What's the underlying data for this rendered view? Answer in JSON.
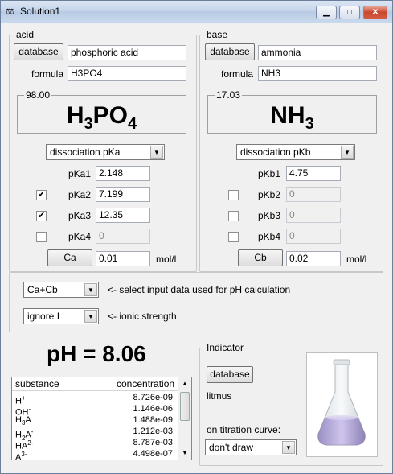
{
  "window": {
    "title": "Solution1",
    "min": "▁",
    "max": "□",
    "close": "✕"
  },
  "acid": {
    "group_label": "acid",
    "database_label": "database",
    "name_value": "phosphoric acid",
    "formula_label": "formula",
    "formula_value": "H3PO4",
    "molar_mass": "98.00",
    "formula_display": {
      "a": "H",
      "sub1": "3",
      "b": "PO",
      "sub2": "4"
    },
    "dissociation_select": "dissociation pKa",
    "pk": [
      {
        "label": "pKa1",
        "value": "2.148",
        "checked": null,
        "enabled": true
      },
      {
        "label": "pKa2",
        "value": "7.199",
        "checked": true,
        "enabled": true
      },
      {
        "label": "pKa3",
        "value": "12.35",
        "checked": true,
        "enabled": true
      },
      {
        "label": "pKa4",
        "value": "0",
        "checked": false,
        "enabled": false
      }
    ],
    "conc_button": "Ca",
    "conc_value": "0.01",
    "unit": "mol/l"
  },
  "base": {
    "group_label": "base",
    "database_label": "database",
    "name_value": "ammonia",
    "formula_label": "formula",
    "formula_value": "NH3",
    "molar_mass": "17.03",
    "formula_display": {
      "a": "NH",
      "sub1": "3"
    },
    "dissociation_select": "dissociation pKb",
    "pk": [
      {
        "label": "pKb1",
        "value": "4.75",
        "checked": null,
        "enabled": true
      },
      {
        "label": "pKb2",
        "value": "0",
        "checked": false,
        "enabled": false
      },
      {
        "label": "pKb3",
        "value": "0",
        "checked": false,
        "enabled": false
      },
      {
        "label": "pKb4",
        "value": "0",
        "checked": false,
        "enabled": false
      }
    ],
    "conc_button": "Cb",
    "conc_value": "0.02",
    "unit": "mol/l"
  },
  "options": {
    "input_select": "Ca+Cb",
    "input_hint": "<- select input data used for pH calculation",
    "ionic_select": "ignore I",
    "ionic_hint": "<- ionic strength"
  },
  "result": {
    "ph_text": "pH = 8.06"
  },
  "table": {
    "headers": [
      "substance",
      "concentration"
    ],
    "rows": [
      {
        "s": "H+",
        "c": "8.726e-09"
      },
      {
        "s": "OH-",
        "c": "1.146e-06"
      },
      {
        "s": "H3A",
        "c": "1.488e-09"
      },
      {
        "s": "H2A-",
        "c": "1.212e-03"
      },
      {
        "s": "HA2-",
        "c": "8.787e-03"
      },
      {
        "s": "A3-",
        "c": "4.498e-07"
      }
    ]
  },
  "indicator": {
    "group_label": "Indicator",
    "database_label": "database",
    "name": "litmus",
    "curve_label": "on titration curve:",
    "curve_select": "don't draw"
  }
}
